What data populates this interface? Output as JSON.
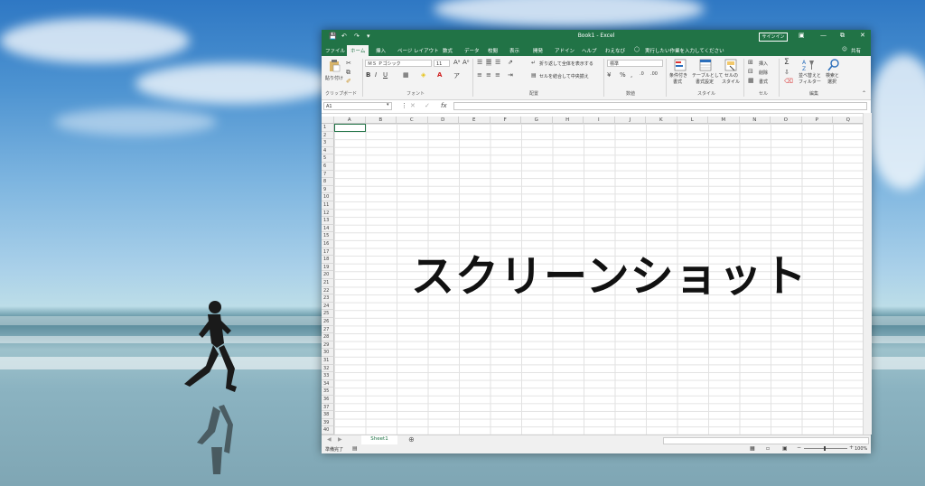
{
  "window": {
    "title": "Book1 - Excel",
    "signin": "サインイン",
    "share": "共有"
  },
  "tabs": [
    "ファイル",
    "ホーム",
    "挿入",
    "ページ レイアウト",
    "数式",
    "データ",
    "校閲",
    "表示",
    "開発",
    "アドイン",
    "ヘルプ",
    "わえなび"
  ],
  "tell_me": "実行したい作業を入力してください",
  "ribbon": {
    "paste": "貼り付け",
    "clipboard": "クリップボード",
    "font_name": "ＭＳ Ｐゴシック",
    "font_size": "11",
    "font_group": "フォント",
    "wrap_text": "折り返して全体を表示する",
    "merge": "セルを結合して中央揃え",
    "align_group": "配置",
    "number_format": "標準",
    "number_group": "数値",
    "cond_format": "条件付き",
    "cond_format2": "書式",
    "table_format": "テーブルとして",
    "table_format2": "書式設定",
    "cell_style": "セルの",
    "cell_style2": "スタイル",
    "style_group": "スタイル",
    "insert": "挿入",
    "delete": "削除",
    "format": "書式",
    "cells_group": "セル",
    "sort": "並べ替えと",
    "sort2": "フィルター",
    "find": "検索と",
    "find2": "選択",
    "edit_group": "編集"
  },
  "name_box": "A1",
  "columns": [
    "A",
    "B",
    "C",
    "D",
    "E",
    "F",
    "G",
    "H",
    "I",
    "J",
    "K",
    "L",
    "M",
    "N",
    "O",
    "P",
    "Q"
  ],
  "rows": [
    "1",
    "2",
    "3",
    "4",
    "5",
    "6",
    "7",
    "8",
    "9",
    "10",
    "11",
    "12",
    "13",
    "14",
    "15",
    "16",
    "17",
    "18",
    "19",
    "20",
    "21",
    "22",
    "23",
    "24",
    "25",
    "26",
    "27",
    "28",
    "29",
    "30",
    "31",
    "32",
    "33",
    "34",
    "35",
    "36",
    "37",
    "38",
    "39",
    "40"
  ],
  "sheet": "Sheet1",
  "status": {
    "ready": "準備完了",
    "zoom": "100%"
  },
  "overlay": "スクリーンショット",
  "colors": {
    "excel_green": "#217346"
  }
}
